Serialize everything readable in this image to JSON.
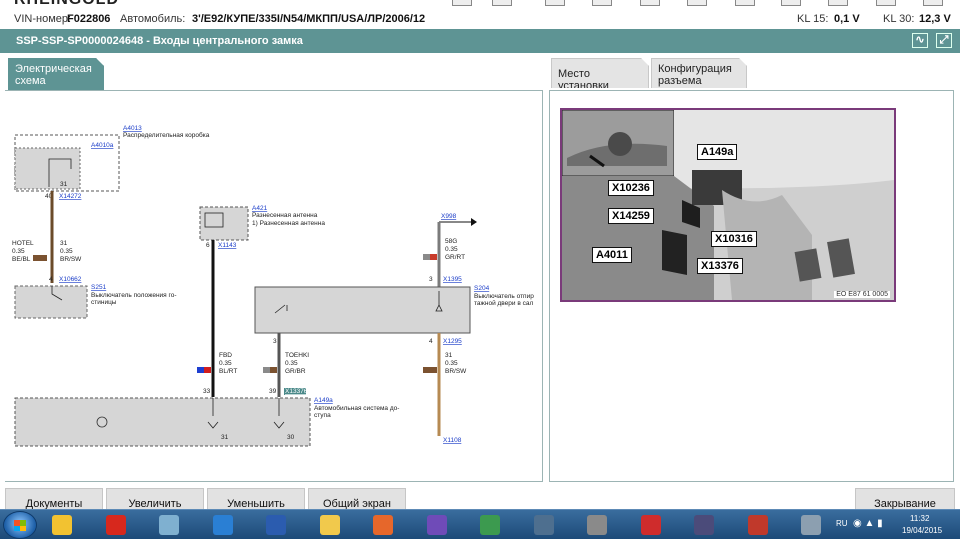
{
  "app": {
    "logo_text": "RHEINGOLD"
  },
  "info_bar": {
    "vin_label": "VIN-номер:",
    "vin_value": "F022806",
    "vehicle_label": "Автомобиль:",
    "vehicle_value": "3'/E92/КУПЕ/335I/N54/МКПП/USA/ЛР/2006/12",
    "kl15_label": "KL 15:",
    "kl15_value": "0,1 V",
    "kl30_label": "KL 30:",
    "kl30_value": "12,3 V"
  },
  "title_bar": {
    "title": "SSP-SSP-SP0000024648 - Входы центрального замка"
  },
  "left_tabs": [
    {
      "label": "Электрическая\nсхема",
      "active": true
    }
  ],
  "right_tabs": [
    {
      "label": "Место установки",
      "active": false
    },
    {
      "label": "Конфигурация\nразъема",
      "active": false
    }
  ],
  "wiring": {
    "a4013": {
      "id": "A4013",
      "desc": "Распределительная коробка"
    },
    "a4010a": "A4010a",
    "x14272": {
      "pin": "40",
      "conn": "X14272"
    },
    "w_left": {
      "name": "HOTEL",
      "size": "0.35",
      "color1": "BE/BL",
      "pin": "31",
      "size2": "0.35",
      "color2": "BR/SW"
    },
    "x10662": {
      "pin": "4",
      "conn": "X10662"
    },
    "s251": {
      "id": "S251",
      "desc1": "Выключатель положения го-",
      "desc2": "стиницы"
    },
    "a421": {
      "id": "A421",
      "desc1": "Разнесенная антенна",
      "desc2": "1)   Разнесенная антенна"
    },
    "x1143": {
      "pin": "6",
      "conn": "X1143"
    },
    "x998": "X998",
    "w_58g": {
      "name": "58G",
      "size": "0.35",
      "color": "GR/RT"
    },
    "x1395": {
      "pin": "3",
      "conn": "X1395"
    },
    "s204": {
      "id": "S204",
      "desc1": "Выключатель отпир",
      "desc2": "тажной двери в сал"
    },
    "x1295": {
      "pin": "4",
      "conn": "X1295"
    },
    "w_fbd": {
      "name": "FBD",
      "size": "0.35",
      "color": "BL/RT",
      "pin": "33"
    },
    "w_toehki": {
      "name": "TOEHKI",
      "size": "0.35",
      "color": "GR/BR",
      "pin3": "3",
      "pin": "39"
    },
    "w_31": {
      "name": "31",
      "size": "0.35",
      "color": "BR/SW"
    },
    "x13376": "X13376",
    "a149a": {
      "id": "A149a",
      "desc1": "Автомобильная система до-",
      "desc2": "ступа"
    },
    "a149a_pins": {
      "p31": "31",
      "p30": "30"
    },
    "x1108": "X1108"
  },
  "location_image": {
    "callouts": [
      "A149a",
      "X10236",
      "X14259",
      "X10316",
      "A4011",
      "X13376"
    ],
    "code": "EO E87 61 0005"
  },
  "buttons": {
    "documents": "Документы",
    "zoom_in": "Увеличить",
    "zoom_out": "Уменьшить",
    "full_screen": "Общий экран",
    "close": "Закрывание"
  },
  "taskbar": {
    "lang": "RU",
    "time": "11:32",
    "date": "19/04/2015",
    "apps": [
      "folder-icon",
      "pdf-icon",
      "notes-icon",
      "ie-icon",
      "word-icon",
      "explorer-icon",
      "firefox-icon",
      "viber-icon",
      "chrome-icon",
      "network-icon",
      "inpa-icon",
      "checklist-icon",
      "ista-icon",
      "cbi-icon",
      "diag-tool-icon"
    ],
    "app_colors": [
      "#f2c231",
      "#d7281d",
      "#7fb0d0",
      "#2a7fd4",
      "#2b5caf",
      "#f1c94c",
      "#e6672b",
      "#6f4bb8",
      "#3c9a4f",
      "#4e6f8f",
      "#8a8a8a",
      "#cf2c2c",
      "#4b4b7a",
      "#c0392b",
      "#8c9fb0"
    ]
  }
}
